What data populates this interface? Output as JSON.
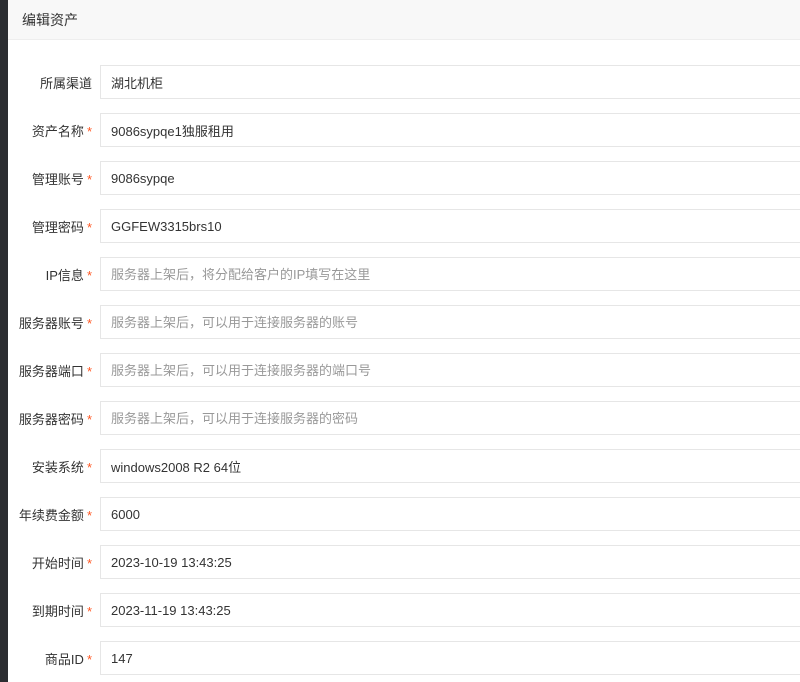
{
  "header": {
    "title": "编辑资产"
  },
  "fields": [
    {
      "label": "所属渠道",
      "required": false,
      "value": "湖北机柜",
      "placeholder": ""
    },
    {
      "label": "资产名称",
      "required": true,
      "value": "9086sypqe1独服租用",
      "placeholder": ""
    },
    {
      "label": "管理账号",
      "required": true,
      "value": "9086sypqe",
      "placeholder": ""
    },
    {
      "label": "管理密码",
      "required": true,
      "value": "GGFEW3315brs10",
      "placeholder": ""
    },
    {
      "label": "IP信息",
      "required": true,
      "value": "",
      "placeholder": "服务器上架后，将分配给客户的IP填写在这里"
    },
    {
      "label": "服务器账号",
      "required": true,
      "value": "",
      "placeholder": "服务器上架后，可以用于连接服务器的账号"
    },
    {
      "label": "服务器端口",
      "required": true,
      "value": "",
      "placeholder": "服务器上架后，可以用于连接服务器的端口号"
    },
    {
      "label": "服务器密码",
      "required": true,
      "value": "",
      "placeholder": "服务器上架后，可以用于连接服务器的密码"
    },
    {
      "label": "安装系统",
      "required": true,
      "value": "windows2008 R2 64位",
      "placeholder": ""
    },
    {
      "label": "年续费金额",
      "required": true,
      "value": "6000",
      "placeholder": ""
    },
    {
      "label": "开始时间",
      "required": true,
      "value": "2023-10-19 13:43:25",
      "placeholder": ""
    },
    {
      "label": "到期时间",
      "required": true,
      "value": "2023-11-19 13:43:25",
      "placeholder": ""
    },
    {
      "label": "商品ID",
      "required": true,
      "value": "147",
      "placeholder": ""
    }
  ],
  "required_mark": "*",
  "colors": {
    "required": "#ff5722",
    "border": "#e6e6e6",
    "header_bg": "#f8f8f8",
    "backdrop": "#2b2d31"
  }
}
